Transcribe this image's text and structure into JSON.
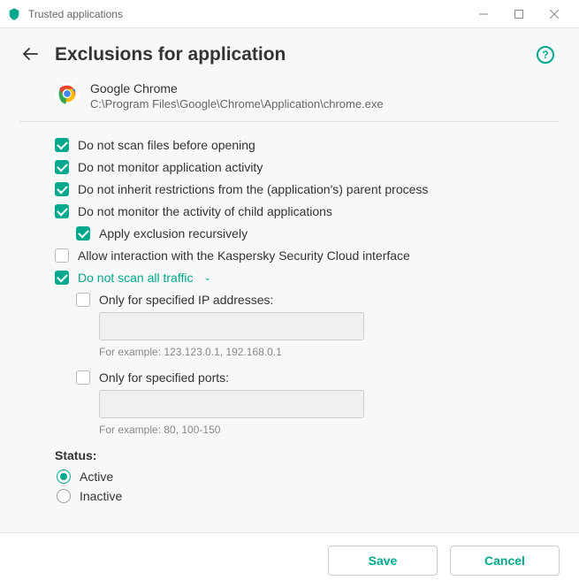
{
  "titlebar": {
    "title": "Trusted applications"
  },
  "header": {
    "title": "Exclusions for application"
  },
  "app": {
    "name": "Google Chrome",
    "path": "C:\\Program Files\\Google\\Chrome\\Application\\chrome.exe"
  },
  "options": {
    "scan_before_opening": {
      "label": "Do not scan files before opening",
      "checked": true
    },
    "monitor_activity": {
      "label": "Do not monitor application activity",
      "checked": true
    },
    "inherit_restrictions": {
      "label": "Do not inherit restrictions from the (application's) parent process",
      "checked": true
    },
    "monitor_child": {
      "label": "Do not monitor the activity of child applications",
      "checked": true
    },
    "apply_recursively": {
      "label": "Apply exclusion recursively",
      "checked": true
    },
    "allow_interaction": {
      "label": "Allow interaction with the Kaspersky Security Cloud interface",
      "checked": false
    },
    "scan_traffic": {
      "label": "Do not scan all traffic",
      "checked": true
    }
  },
  "traffic": {
    "ip": {
      "label": "Only for specified IP addresses:",
      "checked": false,
      "value": "",
      "hint": "For example: 123.123.0.1, 192.168.0.1"
    },
    "ports": {
      "label": "Only for specified ports:",
      "checked": false,
      "value": "",
      "hint": "For example: 80, 100-150"
    }
  },
  "status": {
    "label": "Status:",
    "active": {
      "label": "Active",
      "selected": true
    },
    "inactive": {
      "label": "Inactive",
      "selected": false
    }
  },
  "footer": {
    "save": "Save",
    "cancel": "Cancel"
  }
}
